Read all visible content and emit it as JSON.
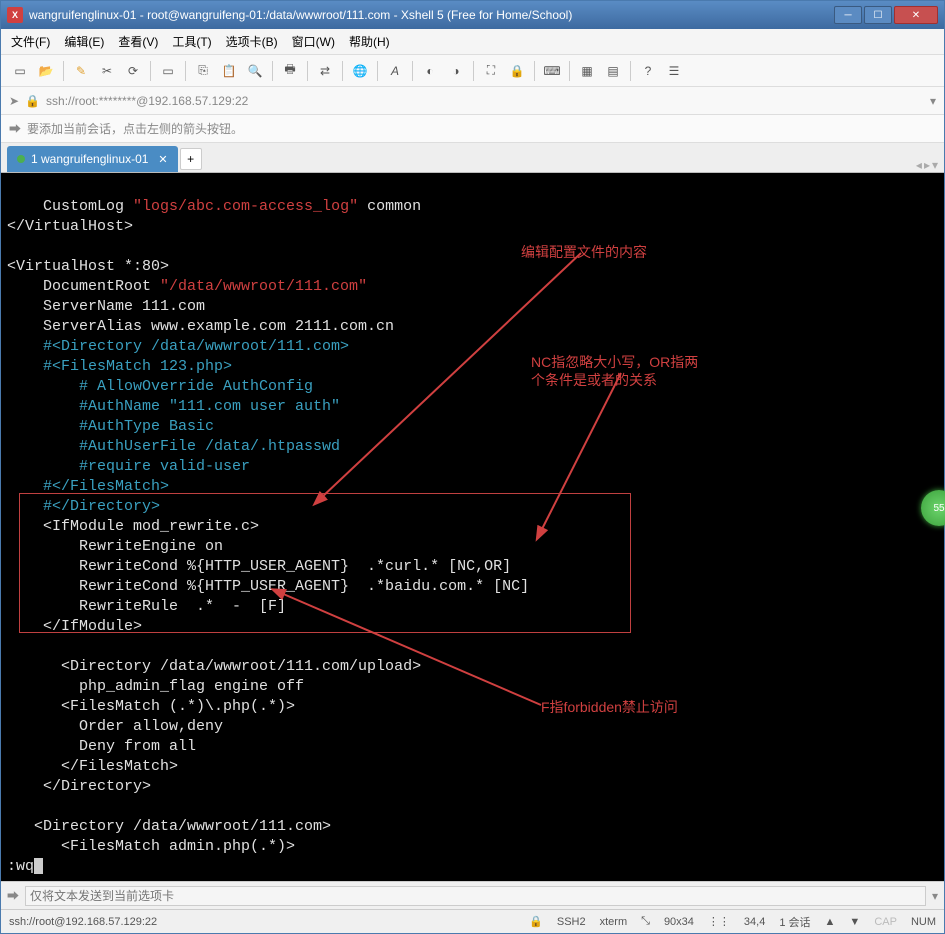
{
  "title": "wangruifenglinux-01 - root@wangruifeng-01:/data/wwwroot/111.com - Xshell 5 (Free for Home/School)",
  "menu": {
    "file": "文件(F)",
    "edit": "编辑(E)",
    "view": "查看(V)",
    "tools": "工具(T)",
    "tab": "选项卡(B)",
    "window": "窗口(W)",
    "help": "帮助(H)"
  },
  "addr": "ssh://root:********@192.168.57.129:22",
  "hint": "要添加当前会话，点击左侧的箭头按钮。",
  "tab_name": "1 wangruifenglinux-01",
  "terminal": {
    "l1": "    CustomLog ",
    "l1q": "\"logs/abc.com-access_log\"",
    "l1b": " common",
    "l2": "</VirtualHost>",
    "l3": "",
    "l4": "<VirtualHost *:80>",
    "l5": "    DocumentRoot ",
    "l5q": "\"/data/wwwroot/111.com\"",
    "l6": "    ServerName 111.com",
    "l7": "    ServerAlias www.example.com 2111.com.cn",
    "l8": "    #<Directory /data/wwwroot/111.com>",
    "l9": "    #<FilesMatch 123.php>",
    "l10": "        # AllowOverride AuthConfig",
    "l11": "        #AuthName \"111.com user auth\"",
    "l12": "        #AuthType Basic",
    "l13": "        #AuthUserFile /data/.htpasswd",
    "l14": "        #require valid-user",
    "l15": "    #</FilesMatch>",
    "l16": "    #</Directory>",
    "l17": "    <IfModule mod_rewrite.c>",
    "l18": "        RewriteEngine on",
    "l19": "        RewriteCond %{HTTP_USER_AGENT}  .*curl.* [NC,OR]",
    "l20": "        RewriteCond %{HTTP_USER_AGENT}  .*baidu.com.* [NC]",
    "l21": "        RewriteRule  .*  -  [F]",
    "l22": "    </IfModule>",
    "l23": "",
    "l24": "      <Directory /data/wwwroot/111.com/upload>",
    "l25": "        php_admin_flag engine off",
    "l26": "      <FilesMatch (.*)\\.php(.*)>",
    "l27": "        Order allow,deny",
    "l28": "        Deny from all",
    "l29": "      </FilesMatch>",
    "l30": "    </Directory>",
    "l31": "",
    "l32": "   <Directory /data/wwwroot/111.com>",
    "l33": "      <FilesMatch admin.php(.*)>",
    "cmd": ":wq"
  },
  "annotations": {
    "a1": "编辑配置文件的内容",
    "a2": "NC指忽略大小写，OR指两个条件是或者的关系",
    "a3": "F指forbidden禁止访问"
  },
  "input_placeholder": "仅将文本发送到当前选项卡",
  "status": {
    "addr": "ssh://root@192.168.57.129:22",
    "ssh": "SSH2",
    "term": "xterm",
    "size": "90x34",
    "pos": "34,4",
    "sess": "1 会话",
    "cap": "CAP",
    "num": "NUM"
  },
  "badge": "55"
}
